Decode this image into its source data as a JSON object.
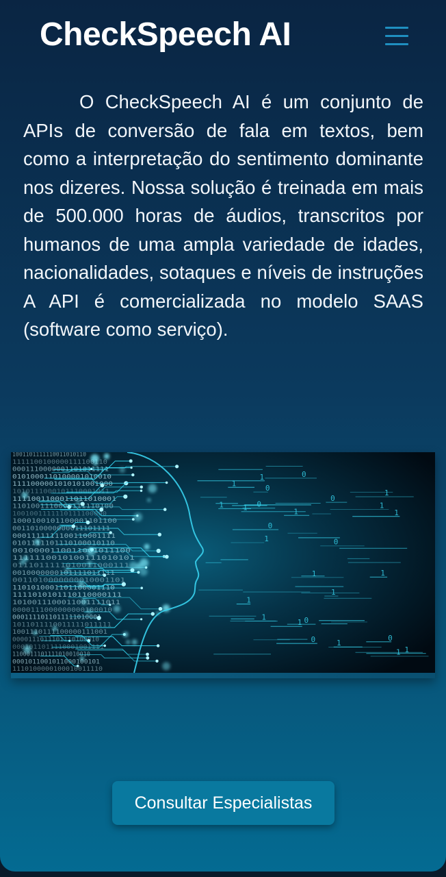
{
  "header": {
    "brand": "CheckSpeech AI",
    "menu_icon": "hamburger-menu-icon"
  },
  "main": {
    "description": "O CheckSpeech AI é um conjunto de APIs de conversão de fala em textos, bem como a interpretação do sentimento dominante nos dizeres. Nossa solução é treinada em mais de 500.000 horas de áudios, transcritos por humanos de uma ampla variedade de idades, nacionalidades, sotaques e níveis de instruções A API é comercializada no modelo SAAS (software como serviço).",
    "hero_image": "ai-circuit-head-illustration",
    "cta_label": "Consultar Especialistas"
  },
  "colors": {
    "accent": "#09799f",
    "menu_icon": "#1f8fc0",
    "circuit": "#36d4ee"
  }
}
